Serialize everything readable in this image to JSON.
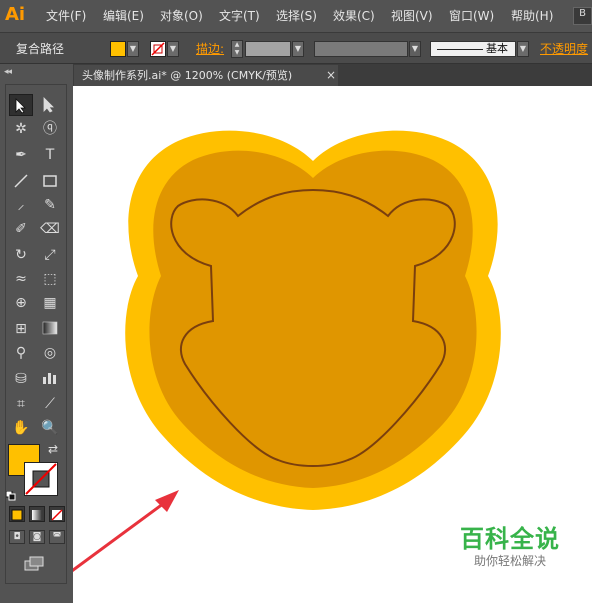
{
  "app": {
    "logo": "Ai"
  },
  "menu": {
    "items": [
      "文件(F)",
      "编辑(E)",
      "对象(O)",
      "文字(T)",
      "选择(S)",
      "效果(C)",
      "视图(V)",
      "窗口(W)",
      "帮助(H)"
    ],
    "right_box": "B"
  },
  "control_bar": {
    "object_type": "复合路径",
    "fill_color": "#ffc000",
    "stroke_label": "描边:",
    "stroke_style_label": "基本",
    "opacity_label": "不透明度"
  },
  "document": {
    "tab_title": "头像制作系列.ai* @ 1200% (CMYK/预览)",
    "close": "×"
  },
  "colors": {
    "outer_shape": "#ffc000",
    "inner_shape": "#e09600",
    "outline_path": "#7a3f0e",
    "annotation_arrow": "#e8323c",
    "fill_swatch": "#ffc000"
  },
  "tools": {
    "icons": [
      "selection-tool-icon",
      "direct-selection-tool-icon",
      "magic-wand-icon",
      "lasso-icon",
      "pen-tool-icon",
      "type-tool-icon",
      "line-segment-icon",
      "rectangle-icon",
      "paintbrush-icon",
      "pencil-icon",
      "blob-brush-icon",
      "eraser-icon",
      "rotate-icon",
      "scale-icon",
      "width-tool-icon",
      "free-transform-icon",
      "shape-builder-icon",
      "perspective-grid-icon",
      "mesh-icon",
      "gradient-icon",
      "eyedropper-icon",
      "blend-icon",
      "symbol-sprayer-icon",
      "column-graph-icon",
      "artboard-icon",
      "slice-icon",
      "hand-icon",
      "zoom-icon"
    ]
  },
  "watermark": {
    "title": "百科全说",
    "subtitle": "助你轻松解决"
  }
}
